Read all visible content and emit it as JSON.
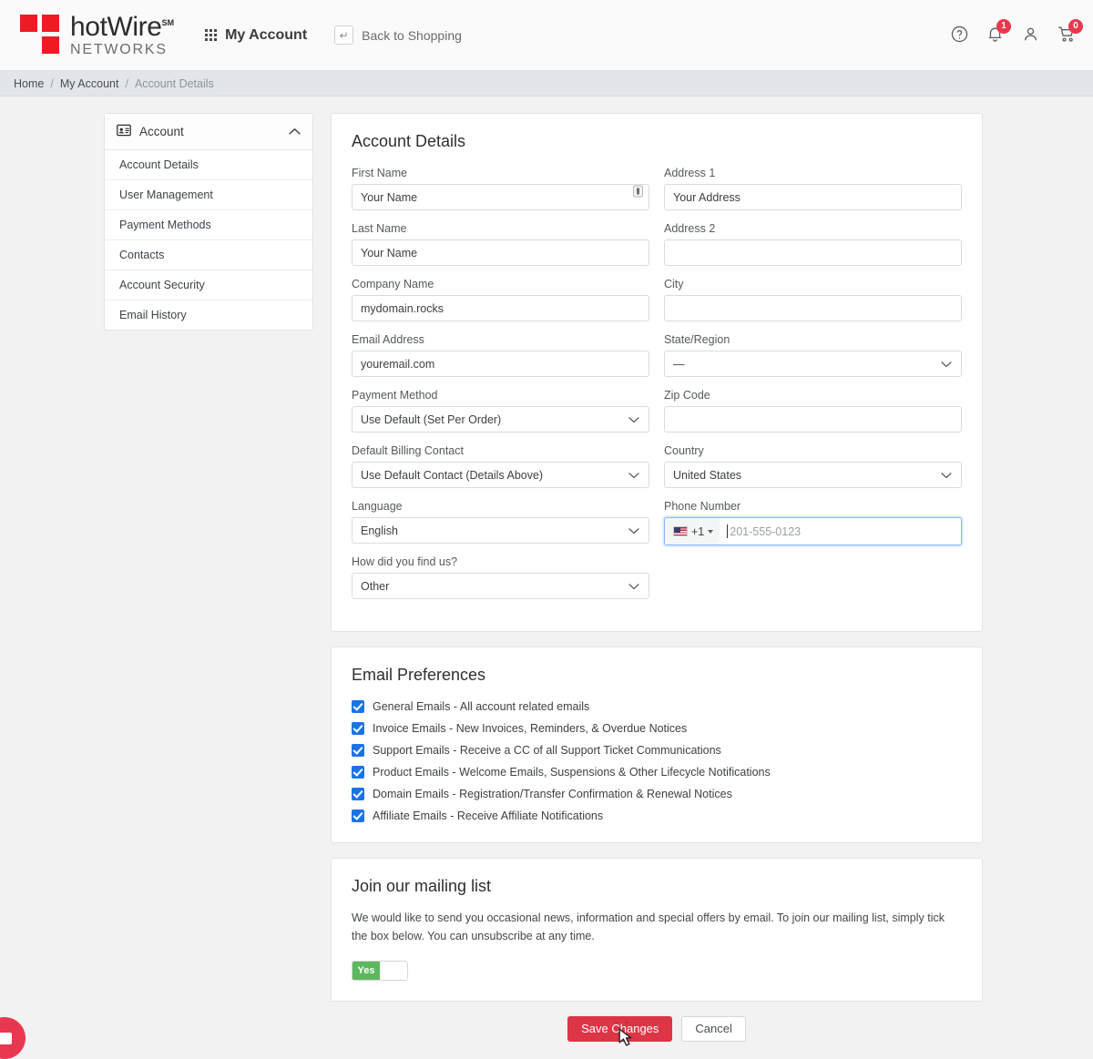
{
  "header": {
    "logo_main": "hotWire",
    "logo_sm": "SM",
    "logo_sub": "NETWORKS",
    "my_account": "My Account",
    "back_to_shopping": "Back to Shopping",
    "icons": {
      "help": "help-circle-icon",
      "bell": "bell-icon",
      "user": "user-icon",
      "cart": "cart-icon"
    },
    "bell_badge": "1",
    "cart_badge": "0"
  },
  "breadcrumb": {
    "home": "Home",
    "sep": "/",
    "my_account": "My Account",
    "current": "Account Details"
  },
  "sidebar": {
    "header_label": "Account",
    "header_icon": "contact-card-icon",
    "collapse_icon": "chevron-up-icon",
    "items": [
      {
        "label": "Account Details"
      },
      {
        "label": "User Management"
      },
      {
        "label": "Payment Methods"
      },
      {
        "label": "Contacts"
      },
      {
        "label": "Account Security"
      },
      {
        "label": "Email History"
      }
    ]
  },
  "account_details": {
    "title": "Account Details",
    "left": [
      {
        "label": "First Name",
        "value": "Your Name",
        "type": "text",
        "trailing_icon": "password-manager-icon"
      },
      {
        "label": "Last Name",
        "value": "Your Name",
        "type": "text"
      },
      {
        "label": "Company Name",
        "value": "mydomain.rocks",
        "type": "text"
      },
      {
        "label": "Email Address",
        "value": "youremail.com",
        "type": "text"
      },
      {
        "label": "Payment Method",
        "value": "Use Default (Set Per Order)",
        "type": "select"
      },
      {
        "label": "Default Billing Contact",
        "value": "Use Default Contact (Details Above)",
        "type": "select"
      },
      {
        "label": "Language",
        "value": "English",
        "type": "select"
      },
      {
        "label": "How did you find us?",
        "value": "Other",
        "type": "select"
      }
    ],
    "right": [
      {
        "label": "Address 1",
        "value": "Your Address",
        "type": "text"
      },
      {
        "label": "Address 2",
        "value": "",
        "type": "text"
      },
      {
        "label": "City",
        "value": "",
        "type": "text"
      },
      {
        "label": "State/Region",
        "value": "—",
        "type": "select"
      },
      {
        "label": "Zip Code",
        "value": "",
        "type": "text"
      },
      {
        "label": "Country",
        "value": "United States",
        "type": "select"
      }
    ],
    "phone": {
      "label": "Phone Number",
      "flag": "us-flag-icon",
      "dial_code": "+1",
      "placeholder": "201-555-0123",
      "value": ""
    }
  },
  "email_preferences": {
    "title": "Email Preferences",
    "items": [
      {
        "label": "General Emails - All account related emails",
        "checked": true
      },
      {
        "label": "Invoice Emails - New Invoices, Reminders, & Overdue Notices",
        "checked": true
      },
      {
        "label": "Support Emails - Receive a CC of all Support Ticket Communications",
        "checked": true
      },
      {
        "label": "Product Emails - Welcome Emails, Suspensions & Other Lifecycle Notifications",
        "checked": true
      },
      {
        "label": "Domain Emails - Registration/Transfer Confirmation & Renewal Notices",
        "checked": true
      },
      {
        "label": "Affiliate Emails - Receive Affiliate Notifications",
        "checked": true
      }
    ]
  },
  "mailing_list": {
    "title": "Join our mailing list",
    "description": "We would like to send you occasional news, information and special offers by email. To join our mailing list, simply tick the box below. You can unsubscribe at any time.",
    "toggle_on_label": "Yes"
  },
  "actions": {
    "save": "Save Changes",
    "cancel": "Cancel"
  },
  "colors": {
    "brand_red": "#ed1c24",
    "save_red": "#dc3545",
    "checkbox_blue": "#1a73e8",
    "toggle_green": "#5cb85c",
    "badge_red": "#e8384f",
    "breadcrumb_bg": "#e2e5e9"
  }
}
